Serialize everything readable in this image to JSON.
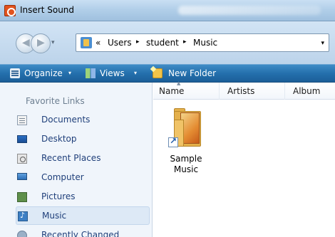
{
  "window": {
    "title": "Insert Sound",
    "title_icon": "insert-sound-icon"
  },
  "address_bar": {
    "prefix": "«",
    "segments": [
      "Users",
      "student",
      "Music"
    ],
    "separator": "▸",
    "dropdown": "▾"
  },
  "toolbar": {
    "organize_label": "Organize",
    "views_label": "Views",
    "new_folder_label": "New Folder",
    "menu_arrow": "▾"
  },
  "left_pane": {
    "title": "Favorite Links",
    "items": [
      {
        "label": "Documents",
        "icon": "documents-icon"
      },
      {
        "label": "Desktop",
        "icon": "desktop-icon"
      },
      {
        "label": "Recent Places",
        "icon": "recent-places-icon"
      },
      {
        "label": "Computer",
        "icon": "computer-icon"
      },
      {
        "label": "Pictures",
        "icon": "pictures-icon"
      },
      {
        "label": "Music",
        "icon": "music-icon",
        "selected": true
      },
      {
        "label": "Recently Changed",
        "icon": "recently-changed-icon"
      }
    ]
  },
  "columns": [
    "Name",
    "Artists",
    "Album"
  ],
  "files": [
    {
      "label_line1": "Sample",
      "label_line2": "Music",
      "icon": "folder-shortcut-icon"
    }
  ],
  "colors": {
    "toolbar_bg": "#2470ad",
    "titlebar_bg": "#b2cfe9",
    "nav_text": "#1f3f7a",
    "selected_bg": "#dde9f6"
  }
}
